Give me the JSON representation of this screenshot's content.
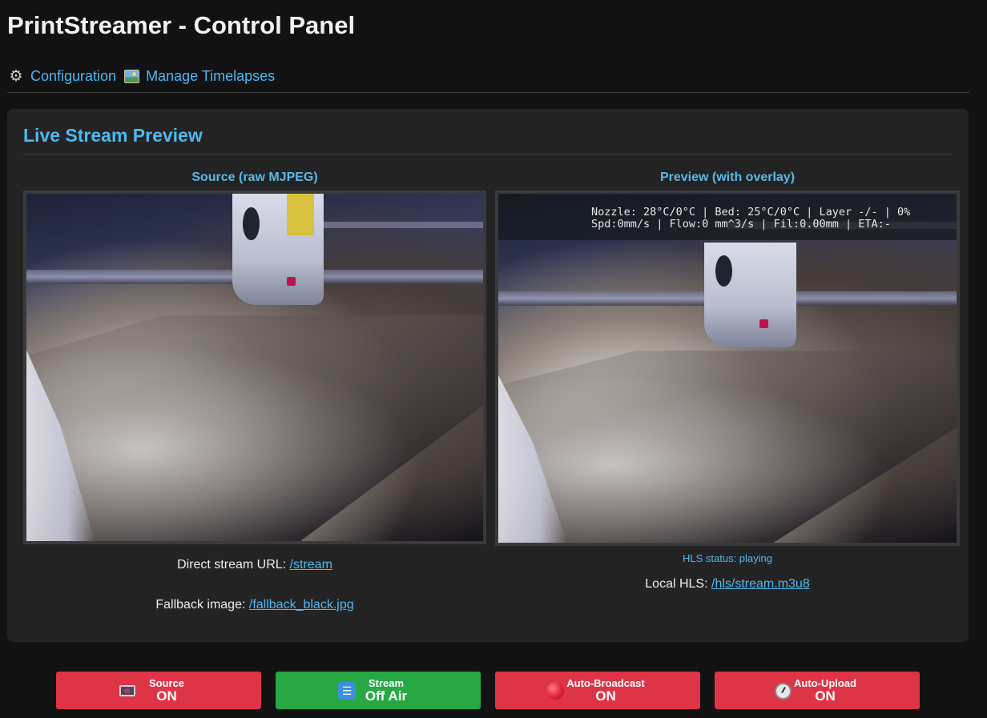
{
  "app": {
    "title": "PrintStreamer - Control Panel"
  },
  "nav": {
    "configuration_label": "Configuration",
    "configuration_icon": "gear-icon",
    "timelapses_label": "Manage Timelapses",
    "timelapses_icon": "picture-icon"
  },
  "preview_panel": {
    "heading": "Live Stream Preview",
    "source": {
      "title": "Source (raw MJPEG)",
      "direct_label": "Direct stream URL:",
      "direct_link": "/stream",
      "fallback_label": "Fallback image:",
      "fallback_link": "/fallback_black.jpg"
    },
    "preview": {
      "title": "Preview (with overlay)",
      "overlay_line1": "Nozzle: 28°C/0°C | Bed: 25°C/0°C | Layer -/- | 0%",
      "overlay_line2": "Spd:0mm/s | Flow:0 mm^3/s | Fil:0.00mm | ETA:-",
      "hls_status": "HLS status: playing",
      "local_hls_label": "Local HLS:",
      "local_hls_link": "/hls/stream.m3u8"
    }
  },
  "controls": [
    {
      "label": "Source",
      "state": "ON",
      "icon": "camera-icon",
      "color": "#dd3547"
    },
    {
      "label": "Stream",
      "state": "Off Air",
      "icon": "wifi-icon",
      "color": "#28a745"
    },
    {
      "label": "Auto-Broadcast",
      "state": "ON",
      "icon": "record-icon",
      "color": "#dd3547"
    },
    {
      "label": "Auto-Upload",
      "state": "ON",
      "icon": "gauge-icon",
      "color": "#dd3547"
    }
  ],
  "colors": {
    "accent": "#4fb8f0",
    "background": "#121212",
    "panel": "#232323"
  }
}
